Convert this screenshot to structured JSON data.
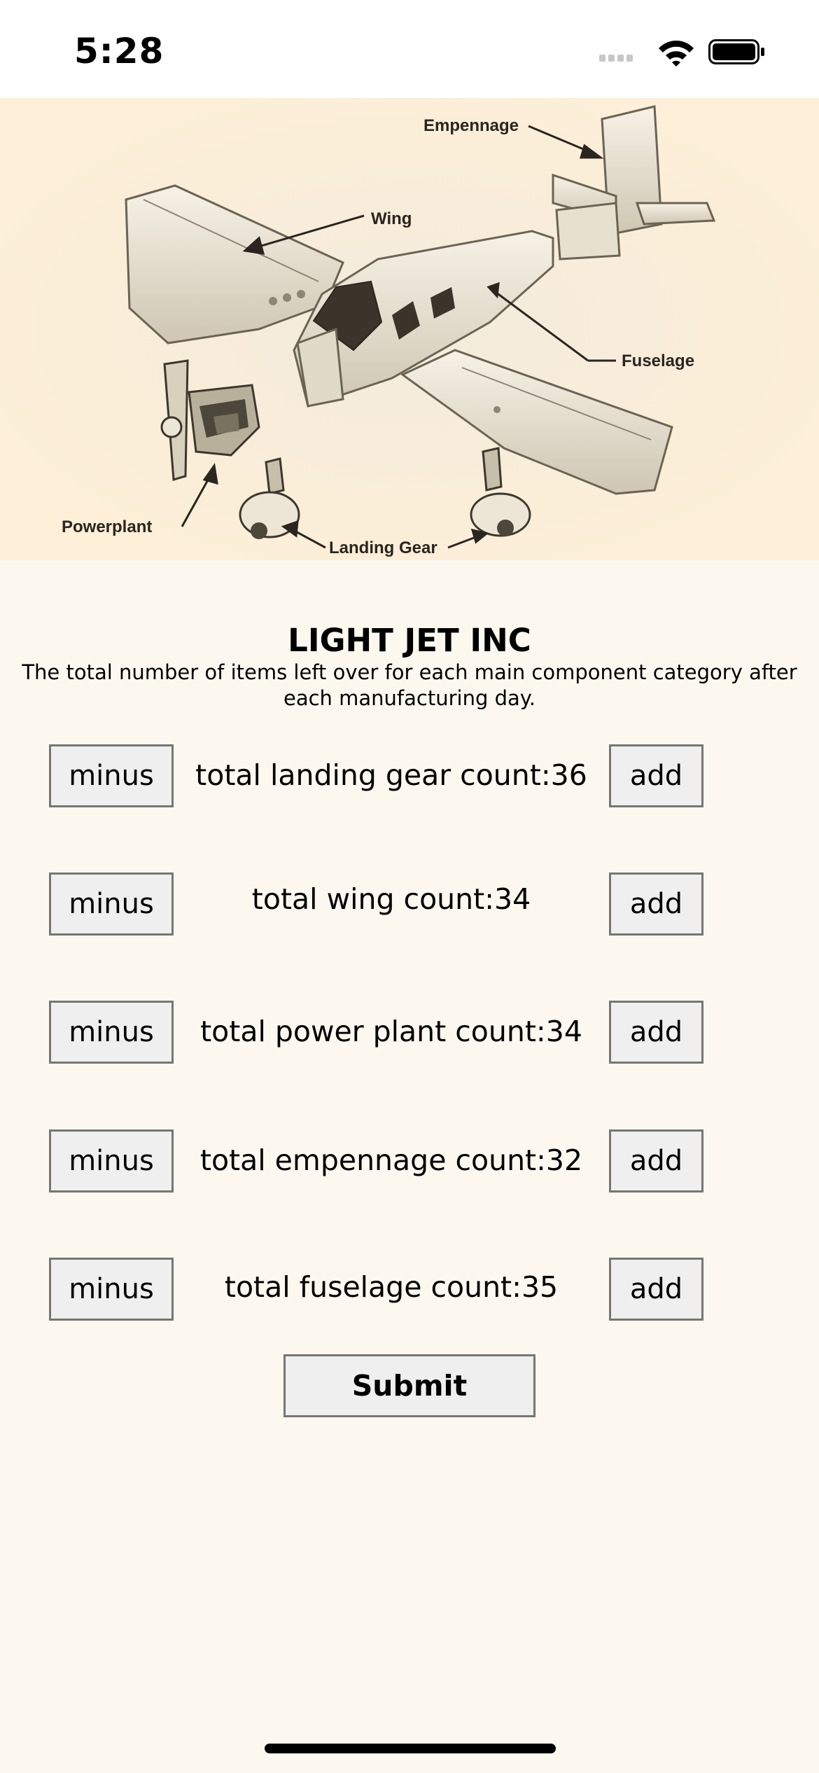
{
  "status_bar": {
    "time": "5:28"
  },
  "hero": {
    "labels": {
      "empennage": "Empennage",
      "wing": "Wing",
      "fuselage": "Fuselage",
      "powerplant": "Powerplant",
      "landing_gear": "Landing Gear"
    }
  },
  "header": {
    "title": "LIGHT JET INC",
    "subtitle": "The total number of items left over for each main component category after each manufacturing day."
  },
  "counters": [
    {
      "minus_label": "minus",
      "label": "total landing gear count:36",
      "add_label": "add"
    },
    {
      "minus_label": "minus",
      "label": "total wing count:34",
      "add_label": "add"
    },
    {
      "minus_label": "minus",
      "label": "total power plant count:34",
      "add_label": "add"
    },
    {
      "minus_label": "minus",
      "label": "total empennage count:32",
      "add_label": "add"
    },
    {
      "minus_label": "minus",
      "label": "total fuselage count:35",
      "add_label": "add"
    }
  ],
  "submit_label": "Submit",
  "colors": {
    "page_background": "#fdf8ef",
    "hero_background": "#fdefd8",
    "button_background": "#efefef",
    "button_border": "#767676"
  }
}
